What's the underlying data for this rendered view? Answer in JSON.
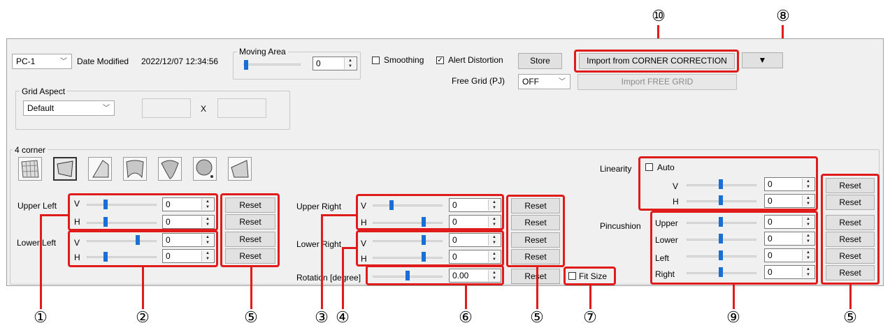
{
  "top": {
    "pc_select": "PC-1",
    "date_modified_label": "Date Modified",
    "date_modified_value": "2022/12/07 12:34:56",
    "moving_area_title": "Moving Area",
    "moving_area_value": "0",
    "smoothing_label": "Smoothing",
    "smoothing_checked": false,
    "alert_distortion_label": "Alert Distortion",
    "alert_distortion_checked": true,
    "store_label": "Store",
    "import_corner_label": "Import from CORNER CORRECTION",
    "dropdown_arrow": "▼",
    "free_grid_label": "Free Grid (PJ)",
    "free_grid_value": "OFF",
    "import_free_grid_label": "Import FREE GRID"
  },
  "grid_aspect": {
    "title": "Grid Aspect",
    "select_value": "Default",
    "x_label": "X"
  },
  "corner": {
    "title": "4 corner",
    "tool_icons": [
      "grid-warp-icon",
      "quad-warp-icon",
      "perspective-warp-icon",
      "curve-warp-icon",
      "arc-warp-icon",
      "sphere-warp-icon",
      "corner-warp-icon"
    ],
    "upper_left_label": "Upper Left",
    "lower_left_label": "Lower Left",
    "upper_right_label": "Upper Right",
    "lower_right_label": "Lower Right",
    "rotation_label": "Rotation [degree]",
    "v": "V",
    "h": "H",
    "ul_v": "0",
    "ul_h": "0",
    "ll_v": "0",
    "ll_h": "0",
    "ur_v": "0",
    "ur_h": "0",
    "lr_v": "0",
    "lr_h": "0",
    "rotation_value": "0.00",
    "reset_label": "Reset",
    "fit_size_label": "Fit Size",
    "fit_size_checked": false
  },
  "linearity": {
    "label": "Linearity",
    "auto_label": "Auto",
    "auto_checked": false,
    "v_value": "0",
    "h_value": "0"
  },
  "pincushion": {
    "label": "Pincushion",
    "upper_label": "Upper",
    "lower_label": "Lower",
    "left_label": "Left",
    "right_label": "Right",
    "upper_value": "0",
    "lower_value": "0",
    "left_value": "0",
    "right_value": "0"
  },
  "callouts": {
    "c1": "①",
    "c2": "②",
    "c3": "③",
    "c4": "④",
    "c5": "⑤",
    "c6": "⑥",
    "c7": "⑦",
    "c8": "⑧",
    "c9": "⑨",
    "c10": "⑩"
  },
  "colors": {
    "highlight": "#e01b1b",
    "slider_thumb": "#1a6fd6",
    "panel_bg": "#f0f0f0"
  }
}
